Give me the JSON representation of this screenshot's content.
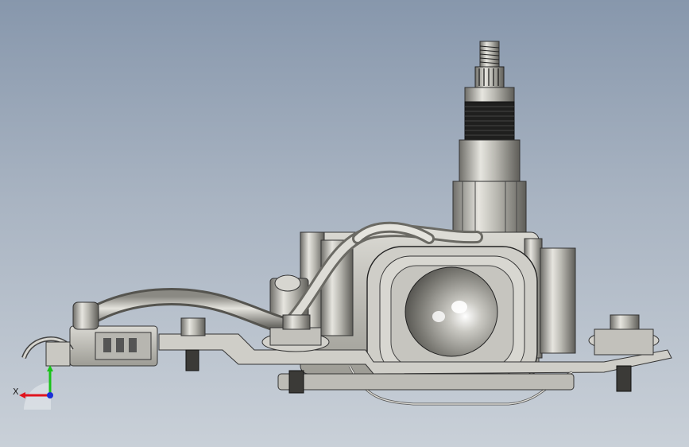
{
  "triad": {
    "x_label": "X",
    "x_color": "#e0141e",
    "y_color": "#19c219",
    "z_color": "#1a2fd6"
  },
  "scene": {
    "background_top": "#8797ac",
    "background_bottom": "#c9d0d8",
    "metal_color": "#c4c3bc"
  }
}
